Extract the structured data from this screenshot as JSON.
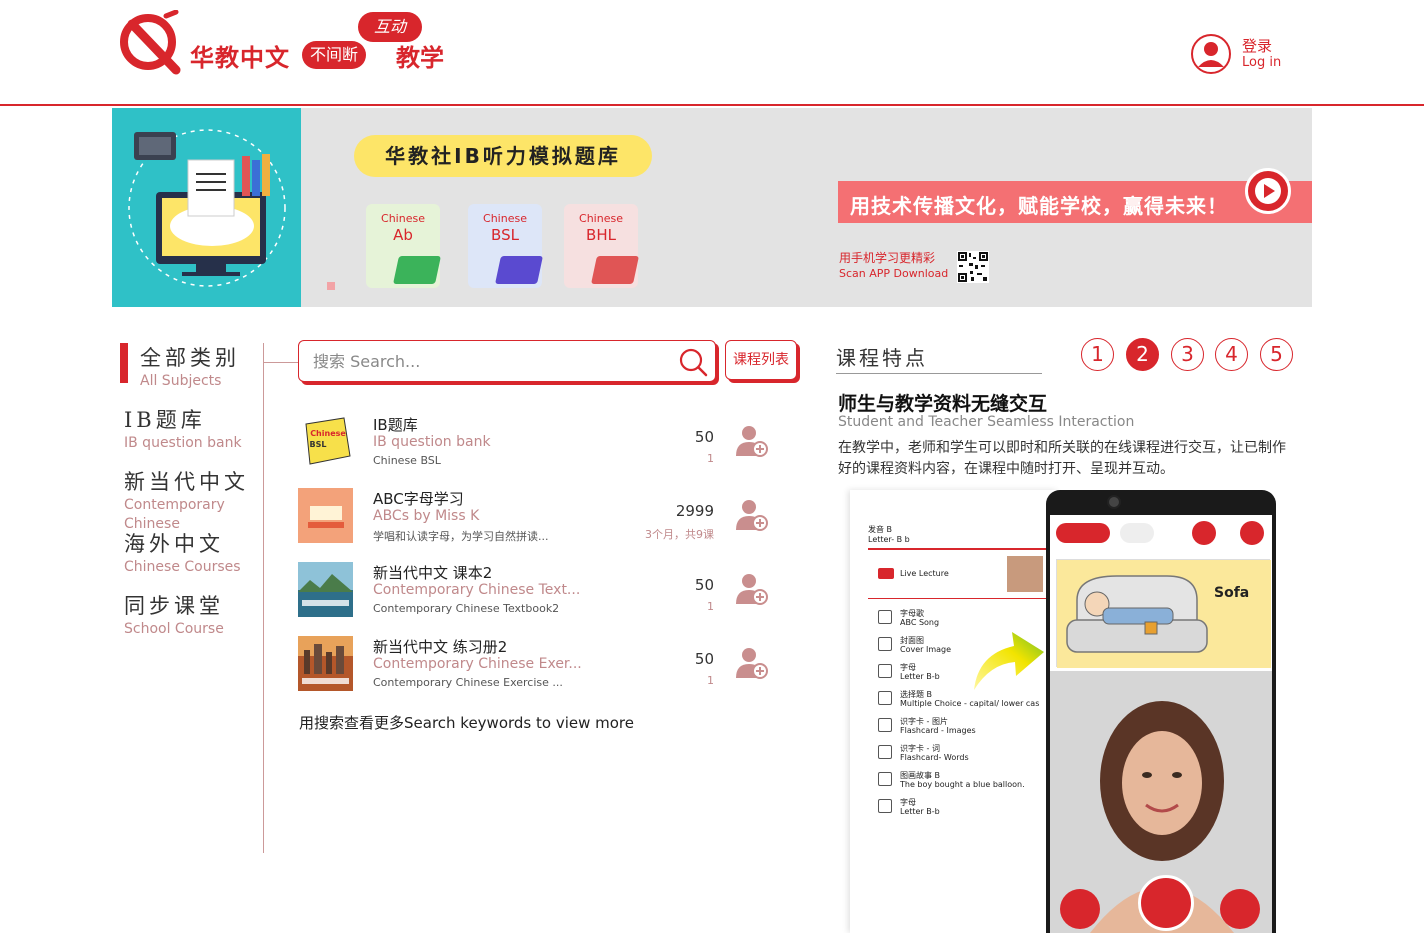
{
  "header": {
    "brand": "华教中文",
    "pill": "不间断",
    "bubble": "互动",
    "teach": "教学",
    "login_zh": "登录",
    "login_en": "Log in"
  },
  "banner": {
    "pill": "华教社IB听力模拟题库",
    "books": [
      {
        "l1": "Chinese",
        "l2": "Ab",
        "bg": "#e6f3d8",
        "color": "#3bb35a"
      },
      {
        "l1": "Chinese",
        "l2": "BSL",
        "bg": "#dde6f8",
        "color": "#5a4ad0"
      },
      {
        "l1": "Chinese",
        "l2": "BHL",
        "bg": "#f6e0e0",
        "color": "#e05555"
      }
    ],
    "slogan": "用技术传播文化，赋能学校，赢得未来！",
    "app_zh": "用手机学习更精彩",
    "app_en": "Scan APP Download"
  },
  "sidebar": {
    "categories": [
      {
        "zh": "全部类别",
        "en": "All Subjects"
      },
      {
        "zh": "IB题库",
        "en": "IB question bank"
      },
      {
        "zh": "新当代中文",
        "en": "Contemporary Chinese"
      },
      {
        "zh": "海外中文",
        "en": "Chinese Courses"
      },
      {
        "zh": "同步课堂",
        "en": "School Course"
      }
    ]
  },
  "search": {
    "placeholder": "搜索 Search...",
    "list_button": "课程列表"
  },
  "courses": [
    {
      "title": "IB题库",
      "subtitle": "IB question bank",
      "desc": "Chinese BSL",
      "price": "50",
      "meta": "1",
      "thumb_color": "#f7e04a",
      "thumb_label": "Chinese BSL"
    },
    {
      "title": "ABC字母学习",
      "subtitle": "ABCs by Miss K",
      "desc": "学唱和认读字母，为学习自然拼读...",
      "price": "2999",
      "meta": "3个月，共9课",
      "thumb_color": "#f3a27a",
      "thumb_label": ""
    },
    {
      "title": "新当代中文 课本2",
      "subtitle": "Contemporary Chinese Text...",
      "desc": "Contemporary Chinese Textbook2",
      "price": "50",
      "meta": "1",
      "thumb_color": "#2e6f8a",
      "thumb_label": ""
    },
    {
      "title": "新当代中文 练习册2",
      "subtitle": "Contemporary Chinese Exer...",
      "desc": "Contemporary Chinese Exercise ...",
      "price": "50",
      "meta": "1",
      "thumb_color": "#b4572a",
      "thumb_label": ""
    }
  ],
  "more_text": "用搜索查看更多Search keywords to view more",
  "features": {
    "heading": "课程特点",
    "pages": [
      "1",
      "2",
      "3",
      "4",
      "5"
    ],
    "active_page": 1,
    "title": "师生与教学资料无缝交互",
    "subtitle": "Student and Teacher Seamless Interaction",
    "desc": "在教学中，老师和学生可以即时和所关联的在线课程进行交互，让已制作好的课程资料内容，在课程中随时打开、呈现并互动。"
  },
  "mock": {
    "head1": "发音 B",
    "head2": "Letter- B b",
    "live": "Live Lecture",
    "items": [
      {
        "zh": "字母歌",
        "en": "ABC Song"
      },
      {
        "zh": "封面图",
        "en": "Cover Image"
      },
      {
        "zh": "字母",
        "en": "Letter B-b"
      },
      {
        "zh": "选择题 B",
        "en": "Multiple Choice - capital/ lower cas"
      },
      {
        "zh": "识字卡 - 图片",
        "en": "Flashcard - Images"
      },
      {
        "zh": "识字卡 - 词",
        "en": "Flashcard- Words"
      },
      {
        "zh": "图画故事 B",
        "en": "The boy bought a blue balloon."
      },
      {
        "zh": "字母",
        "en": "Letter B-b"
      }
    ],
    "sofa": "Sofa"
  }
}
